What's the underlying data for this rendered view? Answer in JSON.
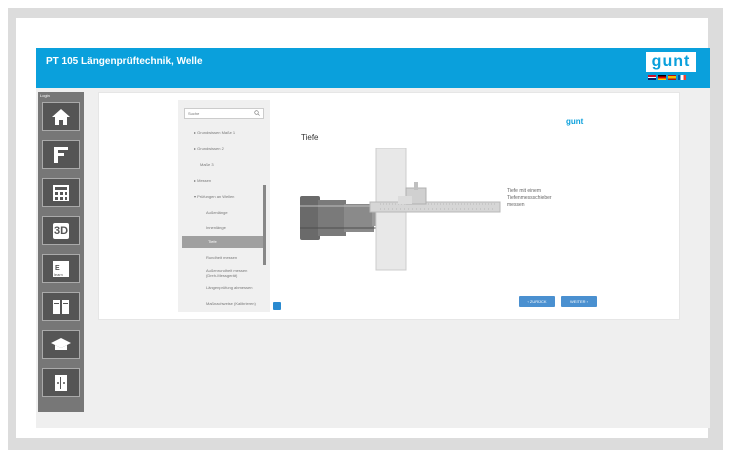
{
  "header": {
    "title": "PT 105 Längenprüftechnik, Welle",
    "logo": "gunt"
  },
  "colors": {
    "accent": "#0aa0dc",
    "button": "#4a90d0",
    "sidebar": "#777777"
  },
  "sidebar": {
    "label": "Login",
    "items": [
      {
        "name": "home",
        "icon": "home-icon"
      },
      {
        "name": "caliper",
        "icon": "caliper-icon"
      },
      {
        "name": "calculator",
        "icon": "calculator-icon"
      },
      {
        "name": "3d",
        "icon": "cube-3d-icon",
        "text": "3D"
      },
      {
        "name": "elearn",
        "icon": "elearning-icon",
        "text": "E-learn"
      },
      {
        "name": "documents",
        "icon": "document-icon"
      },
      {
        "name": "teacher",
        "icon": "graduation-cap-icon"
      },
      {
        "name": "exit",
        "icon": "exit-icon"
      }
    ]
  },
  "nav": {
    "search_placeholder": "Suche",
    "items": [
      "▸ Grundwissen Maße 1",
      "▸ Grundwissen 2",
      "Maße 3",
      "▸ Messen",
      "▾ Prüfungen an Wellen",
      "Außenlänge",
      "Innenlänge",
      "Tiefe",
      "Rundheit messen",
      "Außenrundheit messen (Dreh-Messgerät)",
      "Längenprüfung abmessen",
      "Maßnachweise (Kalibrieren)"
    ],
    "selected_index": 7
  },
  "content": {
    "title": "Tiefe",
    "logo": "gunt",
    "caption": [
      "Tiefe mit einem",
      "Tiefenmessschieber",
      "messen"
    ]
  },
  "buttons": {
    "back": "‹ ZURÜCK",
    "next": "WEITER ›"
  }
}
